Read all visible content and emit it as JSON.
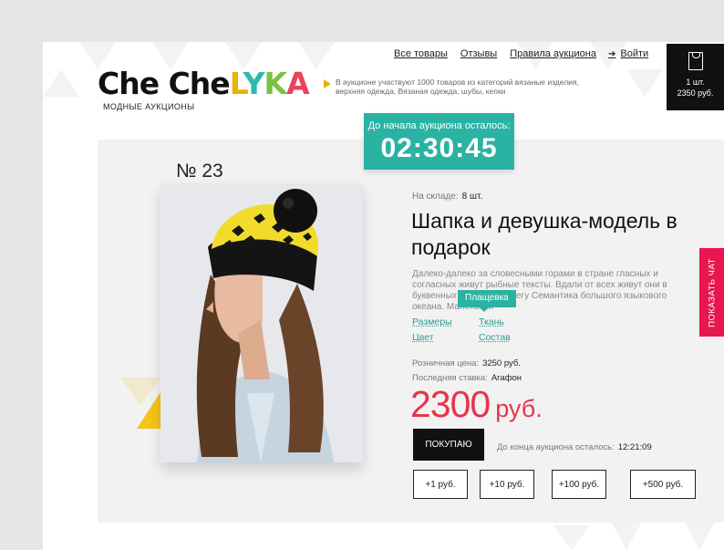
{
  "header": {
    "logo_text": "CheCheLYKA",
    "logo_subtitle": "МОДНЫЕ АУКЦИОНЫ",
    "tagline": "В аукционе участвуют 1000 товаров из категорий вязаные изделия, верхняя одежда, Вязаная одежда, шубы, кепки",
    "nav": [
      "Все товары",
      "Отзывы",
      "Правила аукциона"
    ],
    "login_label": "Войти",
    "login_icon": "login-arrow-icon"
  },
  "cart": {
    "icon": "shopping-bag-icon",
    "quantity": "1 шт.",
    "sum": "2350 руб."
  },
  "timer": {
    "label": "До начала аукциона осталось:",
    "value": "02:30:45"
  },
  "product": {
    "lot_number": "№ 23",
    "stock_label": "На складе:",
    "stock_value": "8 шт.",
    "title": "Шапка и девушка-модель в подарок",
    "description": "Далеко-далеко за словесными горами в стране гласных и согласных живут рыбные тексты. Вдали от всех живут они в буквенных домах на берегу Семантика большого языкового океана. Маленький",
    "tooltip": "Плащевка",
    "links": [
      "Размеры",
      "Ткань",
      "Цвет",
      "Состав"
    ],
    "retail_label": "Розничная цена:",
    "retail_value": "3250 руб.",
    "last_bid_label": "Последняя ставка:",
    "last_bid_value": "Агафон",
    "price_value": "2300",
    "price_currency": "руб.",
    "buy_label": "ПОКУПАЮ",
    "end_timer_label": "До конца аукциона осталось:",
    "end_timer_value": "12:21:09",
    "bids": [
      "+1 руб.",
      "+10 руб.",
      "+100 руб.",
      "+500 руб."
    ]
  },
  "chat": {
    "label": "ПОКАЗАТЬ ЧАТ"
  },
  "colors": {
    "accent": "#2ab3a3",
    "price": "#e8344a",
    "chat": "#e8174f",
    "dark": "#111111"
  }
}
